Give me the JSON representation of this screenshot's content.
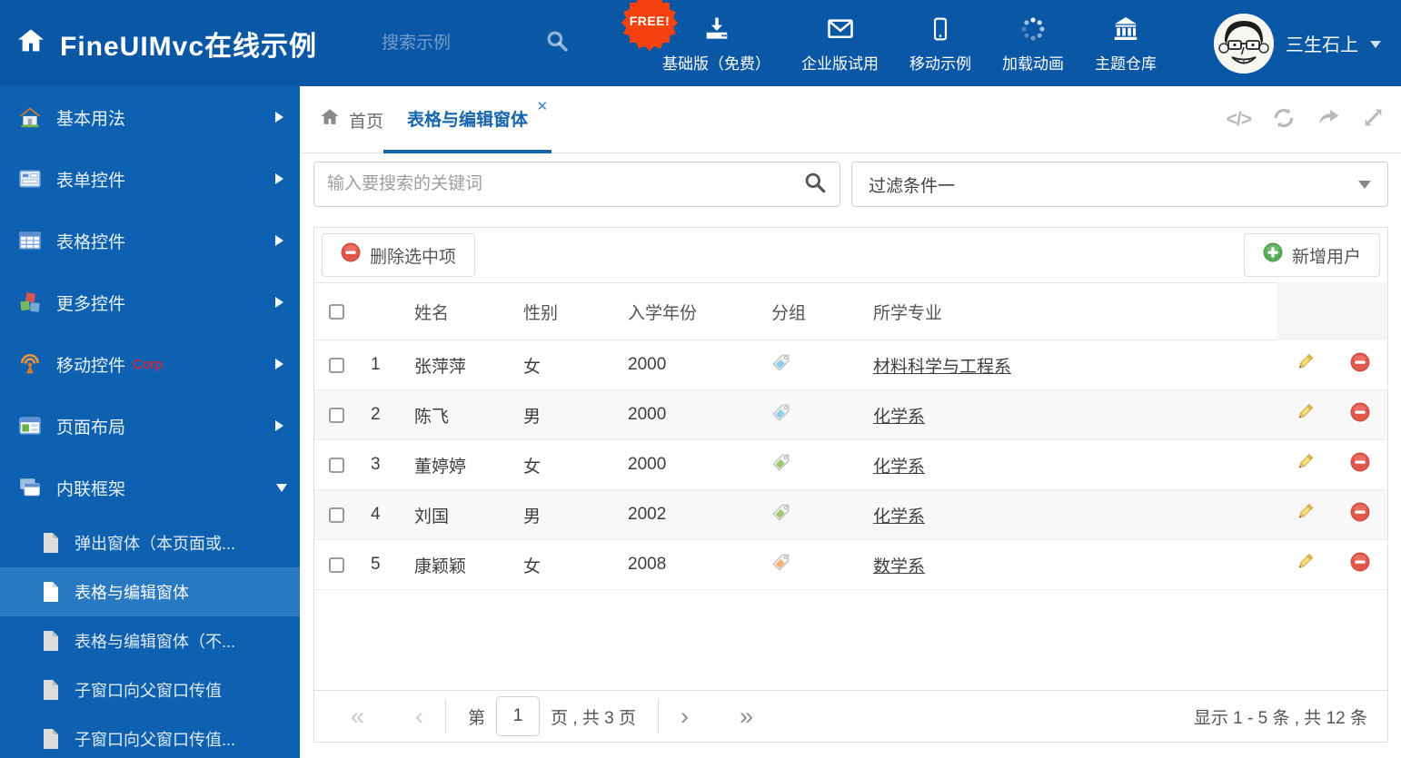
{
  "colors": {
    "header_bg": "#0a57a5",
    "sidebar_bg": "#0e61b0",
    "sidebar_selected_bg": "#2878c2",
    "tab_active_blue": "#1565ad",
    "free_badge_orange": "#f5420e",
    "delete_red": "#e2574c",
    "add_green": "#58ad58",
    "tag_blue": "#8ecdf5",
    "tag_green": "#9cc96d",
    "tag_orange": "#f8b06a"
  },
  "icons": {
    "close": "✕",
    "code": "</>"
  },
  "header": {
    "logo_title": "FineUIMvc在线示例",
    "search_placeholder": "搜索示例",
    "free_badge": "FREE!",
    "nav": [
      {
        "label": "基础版（免费）"
      },
      {
        "label": "企业版试用"
      },
      {
        "label": "移动示例"
      },
      {
        "label": "加载动画"
      },
      {
        "label": "主题仓库"
      }
    ],
    "user_name": "三生石上"
  },
  "sidebar": {
    "items": [
      {
        "label": "基本用法"
      },
      {
        "label": "表单控件"
      },
      {
        "label": "表格控件"
      },
      {
        "label": "更多控件"
      },
      {
        "label": "移动控件",
        "badge": "Corp."
      },
      {
        "label": "页面布局"
      },
      {
        "label": "内联框架"
      }
    ],
    "submenu": [
      {
        "label": "弹出窗体（本页面或..."
      },
      {
        "label": "表格与编辑窗体"
      },
      {
        "label": "表格与编辑窗体（不..."
      },
      {
        "label": "子窗口向父窗口传值"
      },
      {
        "label": "子窗口向父窗口传值..."
      }
    ]
  },
  "tabs": [
    {
      "label": "首页"
    },
    {
      "label": "表格与编辑窗体"
    }
  ],
  "filter": {
    "search_placeholder": "输入要搜索的关键词",
    "dropdown_value": "过滤条件一"
  },
  "toolbar": {
    "delete_label": "删除选中项",
    "add_label": "新增用户"
  },
  "table": {
    "headers": {
      "name": "姓名",
      "gender": "性别",
      "year": "入学年份",
      "group": "分组",
      "major": "所学专业"
    },
    "rows": [
      {
        "index": "1",
        "name": "张萍萍",
        "gender": "女",
        "year": "2000",
        "tag_color": "#8ecdf5",
        "major": "材料科学与工程系"
      },
      {
        "index": "2",
        "name": "陈飞",
        "gender": "男",
        "year": "2000",
        "tag_color": "#8ecdf5",
        "major": "化学系"
      },
      {
        "index": "3",
        "name": "董婷婷",
        "gender": "女",
        "year": "2000",
        "tag_color": "#9cc96d",
        "major": "化学系"
      },
      {
        "index": "4",
        "name": "刘国",
        "gender": "男",
        "year": "2002",
        "tag_color": "#9cc96d",
        "major": "化学系"
      },
      {
        "index": "5",
        "name": "康颖颖",
        "gender": "女",
        "year": "2008",
        "tag_color": "#f8b06a",
        "major": "数学系"
      }
    ]
  },
  "pagination": {
    "first_glyph": "«",
    "prev_glyph": "‹",
    "page_prefix": "第",
    "current_page": "1",
    "page_suffix": "页 , 共 3 页",
    "next_glyph": "›",
    "last_glyph": "»",
    "summary": "显示 1 - 5 条 , 共 12 条"
  }
}
